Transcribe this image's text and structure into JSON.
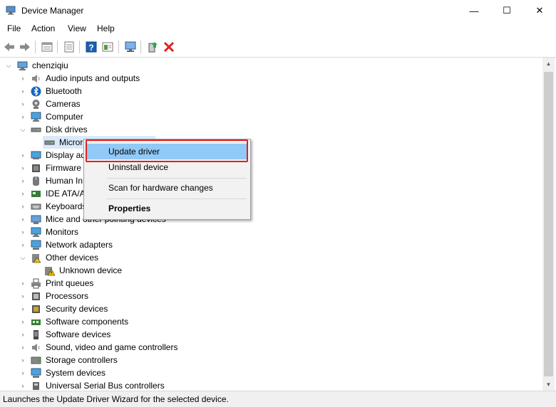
{
  "window": {
    "title": "Device Manager",
    "controls": {
      "minimize": "—",
      "maximize": "☐",
      "close": "✕"
    }
  },
  "menubar": [
    "File",
    "Action",
    "View",
    "Help"
  ],
  "toolbar": [
    "back-icon",
    "forward-icon",
    "properties-icon",
    "list-icon",
    "help-icon",
    "view-icon",
    "scan-hardware-icon",
    "update-driver-icon",
    "uninstall-icon"
  ],
  "tree": {
    "root": "chenziqiu",
    "categories": [
      "Audio inputs and outputs",
      "Bluetooth",
      "Cameras",
      "Computer",
      "Disk drives",
      "Micror",
      "Display ad",
      "Firmware",
      "Human In",
      "IDE ATA/A",
      "Keyboards",
      "Mice and other pointing devices",
      "Monitors",
      "Network adapters",
      "Other devices",
      "Unknown device",
      "Print queues",
      "Processors",
      "Security devices",
      "Software components",
      "Software devices",
      "Sound, video and game controllers",
      "Storage controllers",
      "System devices",
      "Universal Serial Bus controllers"
    ]
  },
  "context_menu": {
    "update_driver": "Update driver",
    "uninstall_device": "Uninstall device",
    "scan_hardware": "Scan for hardware changes",
    "properties": "Properties"
  },
  "status": "Launches the Update Driver Wizard for the selected device.",
  "colors": {
    "selection": "#91c9f7",
    "highlight_border": "#e02020",
    "accent": "#0078d7"
  }
}
